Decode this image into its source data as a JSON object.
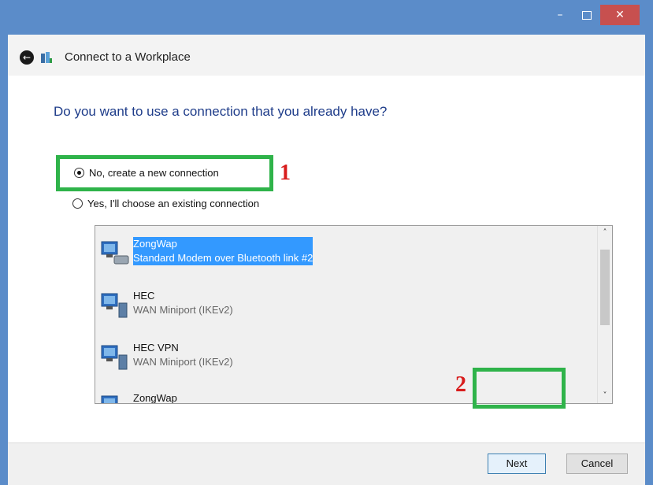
{
  "window": {
    "title": "Connect to a Workplace",
    "controls": {
      "minimize": "–",
      "maximize": "",
      "close": "✕"
    }
  },
  "page": {
    "question": "Do you want to use a connection that you already have?",
    "options": [
      {
        "label": "No, create a new connection",
        "selected": true
      },
      {
        "label": "Yes, I'll choose an existing connection",
        "selected": false
      }
    ],
    "annotations": [
      "1",
      "2"
    ]
  },
  "connections": [
    {
      "name": "ZongWap",
      "device": "Standard Modem over Bluetooth link #2",
      "selected": true,
      "icon": "modem-connection-icon"
    },
    {
      "name": "HEC",
      "device": "WAN Miniport (IKEv2)",
      "selected": false,
      "icon": "vpn-connection-icon"
    },
    {
      "name": "HEC VPN",
      "device": "WAN Miniport (IKEv2)",
      "selected": false,
      "icon": "vpn-connection-icon"
    },
    {
      "name": "ZongWap",
      "device": "",
      "selected": false,
      "icon": "modem-connection-icon"
    }
  ],
  "scrollbar": {
    "up": "˄",
    "down": "˅"
  },
  "footer": {
    "next_label": "Next",
    "cancel_label": "Cancel"
  },
  "colors": {
    "titlebar": "#5b8cc9",
    "close": "#c7504f",
    "selection": "#3399ff",
    "highlight": "#2fb34a",
    "annotation": "#d81c1c",
    "heading": "#1f3d8a"
  }
}
